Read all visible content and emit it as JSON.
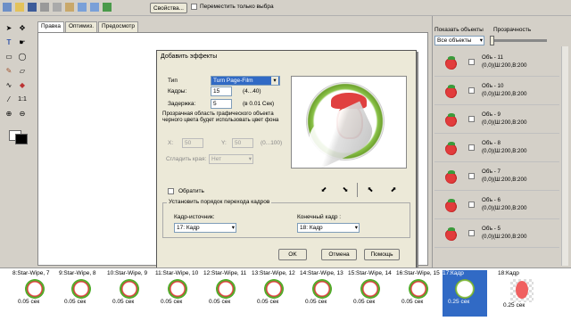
{
  "toolbar": {
    "properties_button": "Свойства...",
    "move_selected_label": "Переместить только выбра"
  },
  "tabs": [
    {
      "label": "Правка"
    },
    {
      "label": "Оптимиз."
    },
    {
      "label": "Предосмотр"
    }
  ],
  "right_panel": {
    "show_objects_label": "Показать объекты",
    "transparency_label": "Прозрачность",
    "show_objects_value": "Все объекты",
    "objects": [
      {
        "name": "Объ - 11",
        "line1": "(0,0)(Ш:200,В:200"
      },
      {
        "name": "Объ - 10",
        "line1": "(0,0)(Ш:200,В:200"
      },
      {
        "name": "Объ - 9",
        "line1": "(0,0)(Ш:200,В:200"
      },
      {
        "name": "Объ - 8",
        "line1": "(0,0)(Ш:200,В:200"
      },
      {
        "name": "Объ - 7",
        "line1": "(0,0)(Ш:200,В:200"
      },
      {
        "name": "Объ - 6",
        "line1": "(0,0)(Ш:200,В:200"
      },
      {
        "name": "Объ - 5",
        "line1": "(0,0)(Ш:200,В:200"
      }
    ]
  },
  "dialog": {
    "title": "Добавить эффекты",
    "type_label": "Тип",
    "type_value": "Turn Page-Film",
    "frames_label": "Кадры:",
    "frames_value": "15",
    "frames_range": "(4...40)",
    "delay_label": "Задержка:",
    "delay_value": "5",
    "delay_unit": "(в 0.01 Сек)",
    "transparency_note": "Прозрачная область графического объекта черного цвета будет использовать цвет фона",
    "x_label": "X:",
    "x_value": "50",
    "y_label": "Y:",
    "y_value": "50",
    "xy_range": "(0...100)",
    "smooth_label": "Сгладить края:",
    "smooth_value": "Нет",
    "reverse_label": "Обратить",
    "order_group_label": "Установить порядок перехода кадров",
    "source_label": "Кадр-источник:",
    "source_value": "17: Кадр",
    "target_label": "Конечный кадр :",
    "target_value": "18: Кадр",
    "ok": "OK",
    "cancel": "Отмена",
    "help": "Помощь"
  },
  "timeline": {
    "frames": [
      {
        "label": "8:Star-Wipe, 7",
        "time": "0.05 сек"
      },
      {
        "label": "9:Star-Wipe, 8",
        "time": "0.05 сек"
      },
      {
        "label": "10:Star-Wipe, 9",
        "time": "0.05 сек"
      },
      {
        "label": "11:Star-Wipe, 10",
        "time": "0.05 сек"
      },
      {
        "label": "12:Star-Wipe, 11",
        "time": "0.05 сек"
      },
      {
        "label": "13:Star-Wipe, 12",
        "time": "0.05 сек"
      },
      {
        "label": "14:Star-Wipe, 13",
        "time": "0.05 сек"
      },
      {
        "label": "15:Star-Wipe, 14",
        "time": "0.05 сек"
      },
      {
        "label": "16:Star-Wipe, 15",
        "time": "0.05 сек"
      },
      {
        "label": "17:Кадр",
        "time": "0.25 сек"
      },
      {
        "label": "18:Кадр",
        "time": "0.25 сек"
      }
    ]
  }
}
